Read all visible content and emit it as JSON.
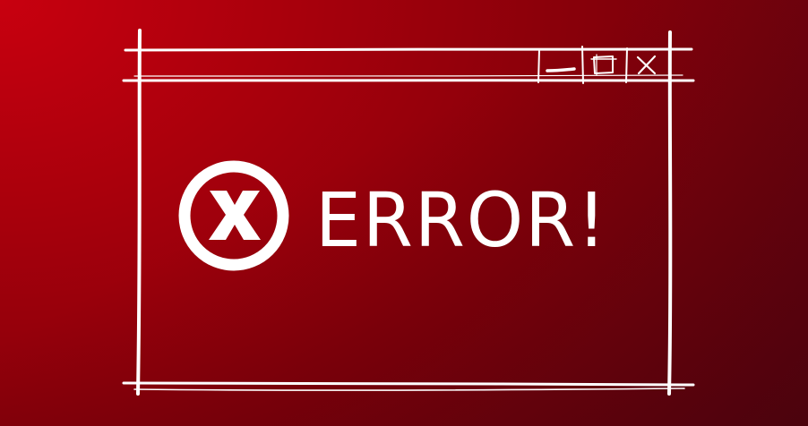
{
  "window": {
    "message": "ERROR!",
    "error_icon": "x-circle-icon",
    "controls": {
      "minimize_icon": "minimize-icon",
      "maximize_icon": "maximize-icon",
      "close_icon": "close-icon"
    }
  },
  "colors": {
    "background_start": "#c8000f",
    "background_end": "#5f0410",
    "stroke": "#ffffff"
  }
}
